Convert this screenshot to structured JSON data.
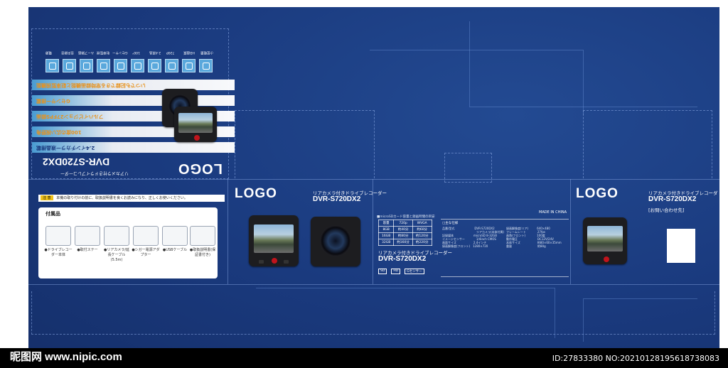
{
  "brand": {
    "logo": "LOGO",
    "product_subtitle": "リアカメラ付きドライブレコーダー",
    "model": "DVR-S720DX2",
    "inquiry": "[お問い合わせ先]",
    "made_in": "MADE IN CHINA"
  },
  "top_panel": {
    "feature_bands": [
      "2.4インチカラー液晶搭載",
      "100度の広い視野角",
      "フルハイビジョン27FPS録画",
      "Gセンサー搭載",
      "いつでも記録できる常時録画機能と駐車監視機能"
    ],
    "icon_labels": [
      "小型軽量",
      "HD画質",
      "720P",
      "2.4液晶",
      "100°",
      "Gセンサー",
      "駐車監視",
      "ループ録画",
      "音声録音",
      "電源"
    ]
  },
  "warning": {
    "icon": "注 意",
    "text": "本機の取り付けの前に、取扱説明書を良くお読みになり、正しくお使いください。"
  },
  "accessories": {
    "title": "付属品",
    "items": [
      "●ドライブレコーダー本体",
      "●取付ステー",
      "●リアカメラ/延長ケーブル(5.5m)",
      "●シガー電源アダプター",
      "●USBケーブル",
      "●取扱説明書(保証書付き)"
    ]
  },
  "side_panel": {
    "table_title": "■microSDカード容量と録画時間の目安",
    "table_headers": [
      "容量",
      "720p",
      "WVGA"
    ],
    "table_rows": [
      [
        "8GB",
        "約40分",
        "約60分"
      ],
      [
        "16GB",
        "約80分",
        "約120分"
      ],
      [
        "32GB",
        "約160分",
        "約220分"
      ]
    ],
    "compat_icons": [
      "SD",
      "HD",
      "Gセンサー"
    ]
  },
  "spec": {
    "title": "□主な仕様",
    "lines": [
      "品番/型式　　　　　　　DVR-S720DX2",
      "　　　　　　　　　　　　リアカメラ(本体付属)",
      "記録媒体　　　　　　　microSD 8-32GB",
      "イメージセンサー　　　　1/4inch CMOS",
      "画面サイズ　　　　　　2.4インチ",
      "録画解像度(フロント)　1280×720",
      "録画解像度(リア)　　　640×480",
      "フレームレート　　　　27fps",
      "画角(フロント)　　　　100度",
      "動作電圧　　　　　　　DC12V/24V",
      "本体サイズ　　　　　　約80×60×35mm",
      "重量　　　　　　　　　約80g"
    ]
  },
  "watermark": {
    "site": "昵图网 www.nipic.com",
    "id_text": "ID:27833380 NO:20210128195618738083"
  }
}
